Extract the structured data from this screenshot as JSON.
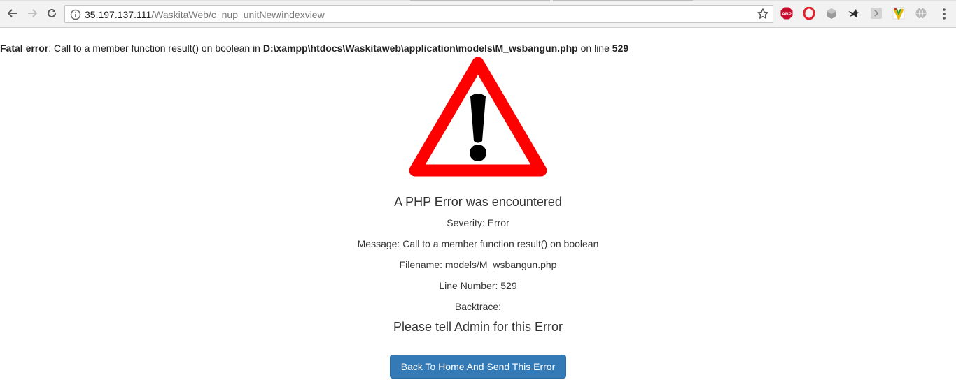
{
  "browser": {
    "url_host": "35.197.137.111",
    "url_path": "/WaskitaWeb/c_nup_unitNew/indexview",
    "extensions": [
      "adblock-plus-icon",
      "opera-icon",
      "cube-extension-icon",
      "bird-extension-icon",
      "arrow-extension-icon",
      "vivaldi-extension-icon",
      "globe-extension-icon"
    ],
    "extension_labels": {
      "abp": "ABP"
    }
  },
  "fatal": {
    "label": "Fatal error",
    "message": ": Call to a member function result() on boolean in ",
    "path": "D:\\xampp\\htdocs\\Waskitaweb\\application\\models\\M_wsbangun.php",
    "on_line": " on line ",
    "line": "529"
  },
  "error_panel": {
    "title": "A PHP Error was encountered",
    "severity": "Severity: Error",
    "message": "Message: Call to a member function result() on boolean",
    "filename": "Filename: models/M_wsbangun.php",
    "line_number": "Line Number: 529",
    "backtrace": "Backtrace:",
    "tell_admin": "Please tell Admin for this Error",
    "button_label": "Back To Home And Send This Error"
  },
  "colors": {
    "warning_red": "#ff0000",
    "button_blue": "#337ab7"
  }
}
